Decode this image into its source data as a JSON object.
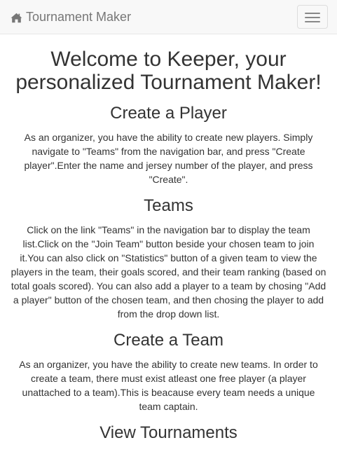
{
  "navbar": {
    "brand_icon": "home-icon",
    "brand_label": "Tournament Maker",
    "toggle_icon": "hamburger-menu-icon",
    "background": "#f8f8f8",
    "brand_color": "#777777"
  },
  "main": {
    "title": "Welcome to Keeper, your personalized Tournament Maker!",
    "sections": [
      {
        "heading": "Create a Player",
        "body": "As an organizer, you have the ability to create new players. Simply navigate to \"Teams\" from the navigation bar, and press \"Create player\".Enter the name and jersey number of the player, and press \"Create\"."
      },
      {
        "heading": "Teams",
        "body": "Click on the link \"Teams\" in the navigation bar to display the team list.Click on the \"Join Team\" button beside your chosen team to join it.You can also click on \"Statistics\" button of a given team to view the players in the team, their goals scored, and their team ranking (based on total goals scored). You can also add a player to a team by chosing \"Add a player\" button of the chosen team, and then chosing the player to add from the drop down list."
      },
      {
        "heading": "Create a Team",
        "body": "As an organizer, you have the ability to create new teams. In order to create a team, there must exist atleast one free player (a player unattached to a team).This is beacause every team needs a unique team captain."
      },
      {
        "heading": "View Tournaments",
        "body": ""
      }
    ]
  }
}
